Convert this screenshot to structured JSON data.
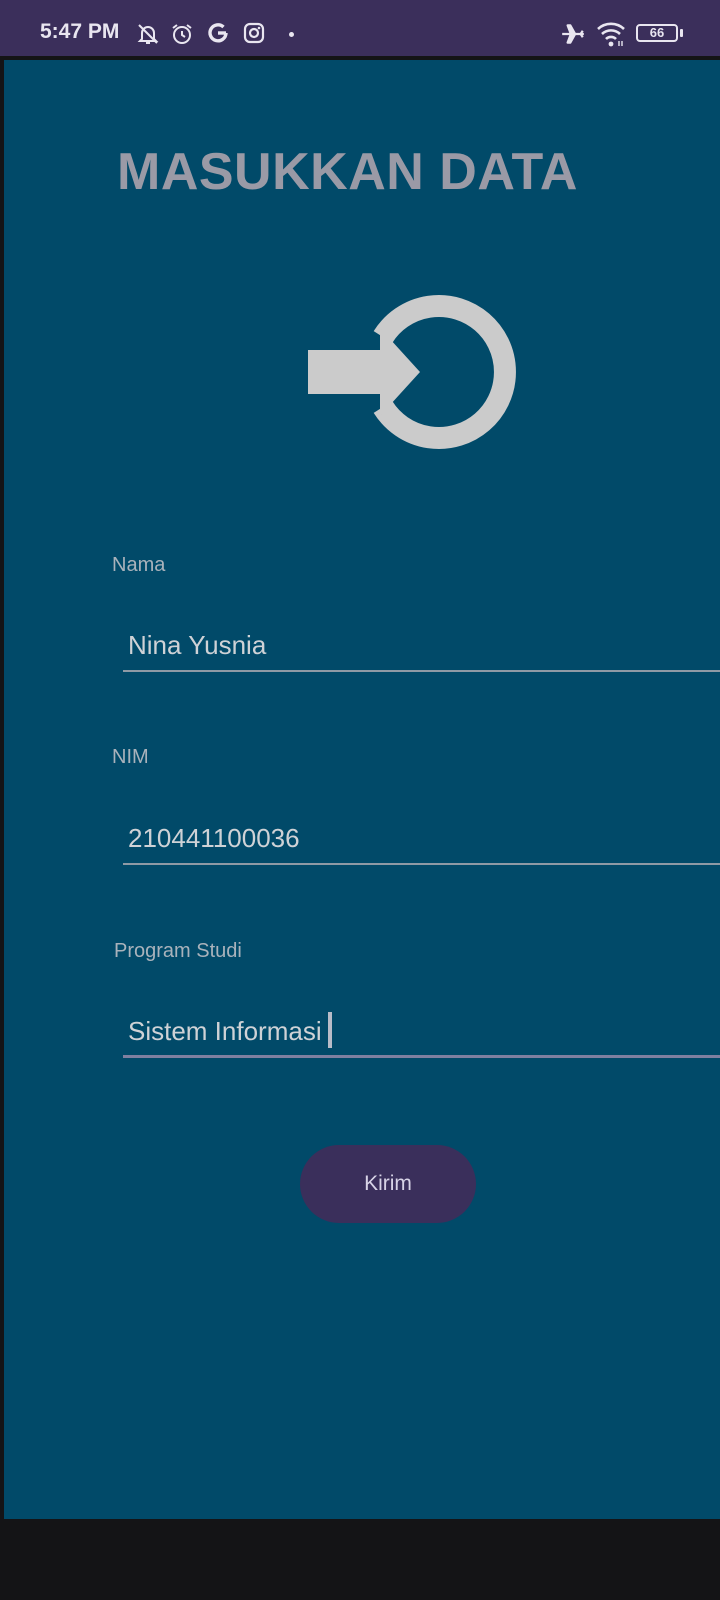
{
  "status_bar": {
    "time": "5:47 PM",
    "battery_level": "66",
    "icons": [
      "notifications-off-icon",
      "alarm-icon",
      "google-icon",
      "instagram-icon",
      "dot-icon",
      "airplane-mode-icon",
      "wifi-icon",
      "battery-icon"
    ]
  },
  "page": {
    "title": "MASUKKAN DATA",
    "header_icon": "login-icon"
  },
  "form": {
    "nama": {
      "label": "Nama",
      "value": "Nina Yusnia"
    },
    "nim": {
      "label": "NIM",
      "value": "210441100036"
    },
    "program_studi": {
      "label": "Program Studi",
      "value": "Sistem Informasi"
    }
  },
  "submit": {
    "label": "Kirim"
  },
  "colors": {
    "status_bar": "#3b2f5b",
    "background": "#014a69",
    "title": "#9a9aa6",
    "icon": "#cbcbcb",
    "button": "#3a2f5b",
    "button_text": "#d7d3e6"
  }
}
